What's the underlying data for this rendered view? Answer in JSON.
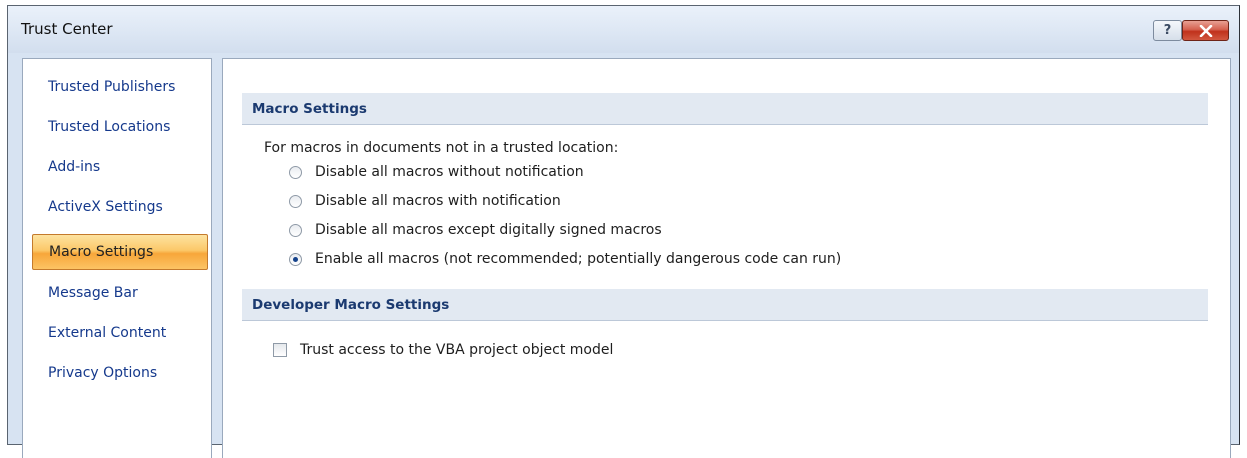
{
  "window": {
    "title": "Trust Center",
    "help_symbol": "?"
  },
  "sidebar": {
    "items": [
      {
        "label": "Trusted Publishers"
      },
      {
        "label": "Trusted Locations"
      },
      {
        "label": "Add-ins"
      },
      {
        "label": "ActiveX Settings"
      },
      {
        "label": "Macro Settings",
        "selected": true
      },
      {
        "label": "Message Bar"
      },
      {
        "label": "External Content"
      },
      {
        "label": "Privacy Options"
      }
    ]
  },
  "macro_settings": {
    "header": "Macro Settings",
    "prompt": "For macros in documents not in a trusted location:",
    "options": [
      {
        "label": "Disable all macros without notification",
        "checked": false
      },
      {
        "label": "Disable all macros with notification",
        "checked": false
      },
      {
        "label": "Disable all macros except digitally signed macros",
        "checked": false
      },
      {
        "label": "Enable all macros (not recommended; potentially dangerous code can run)",
        "checked": true
      }
    ]
  },
  "developer_settings": {
    "header": "Developer Macro Settings",
    "trust_vba_label": "Trust access to the VBA project object model",
    "trust_vba_checked": false
  },
  "colors": {
    "link_text": "#15398c",
    "section_header_bg": "#e2e9f2",
    "selected_item": "#f7a63a"
  }
}
